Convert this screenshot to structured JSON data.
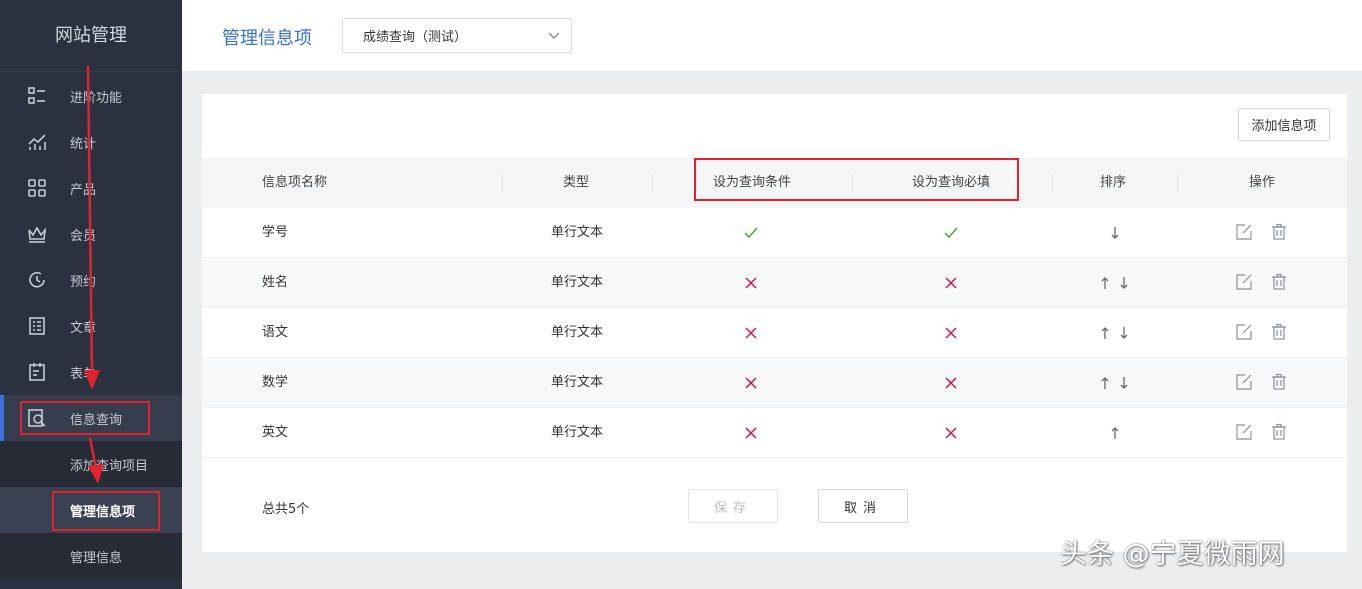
{
  "sidebar": {
    "brand": "网站管理",
    "items": [
      {
        "label": "进阶功能",
        "icon": "list-icon"
      },
      {
        "label": "统计",
        "icon": "chart-icon"
      },
      {
        "label": "产品",
        "icon": "grid-icon"
      },
      {
        "label": "会员",
        "icon": "crown-icon"
      },
      {
        "label": "预约",
        "icon": "clock-icon"
      },
      {
        "label": "文章",
        "icon": "document-icon"
      },
      {
        "label": "表单",
        "icon": "clipboard-icon"
      },
      {
        "label": "信息查询",
        "icon": "search-doc-icon"
      }
    ],
    "subitems": [
      {
        "label": "添加查询项目"
      },
      {
        "label": "管理信息项"
      },
      {
        "label": "管理信息"
      }
    ]
  },
  "header": {
    "title": "管理信息项",
    "select_value": "成绩查询（测试）"
  },
  "card": {
    "add_button": "添加信息项",
    "columns": [
      "信息项名称",
      "类型",
      "设为查询条件",
      "设为查询必填",
      "排序",
      "操作"
    ],
    "rows": [
      {
        "name": "学号",
        "type": "单行文本",
        "query_condition": true,
        "query_required": true,
        "sort": [
          "down"
        ]
      },
      {
        "name": "姓名",
        "type": "单行文本",
        "query_condition": false,
        "query_required": false,
        "sort": [
          "up",
          "down"
        ]
      },
      {
        "name": "语文",
        "type": "单行文本",
        "query_condition": false,
        "query_required": false,
        "sort": [
          "up",
          "down"
        ]
      },
      {
        "name": "数学",
        "type": "单行文本",
        "query_condition": false,
        "query_required": false,
        "sort": [
          "up",
          "down"
        ]
      },
      {
        "name": "英文",
        "type": "单行文本",
        "query_condition": false,
        "query_required": false,
        "sort": [
          "up"
        ]
      }
    ],
    "total": "总共5个",
    "save_label": "保存",
    "cancel_label": "取消"
  },
  "colors": {
    "sidebar_bg": "#2b313e",
    "accent": "#3b6fd4",
    "check": "#52a23a",
    "cross": "#c7194b",
    "annotation": "#e0232e"
  },
  "watermark": "头条 @宁夏微雨网"
}
